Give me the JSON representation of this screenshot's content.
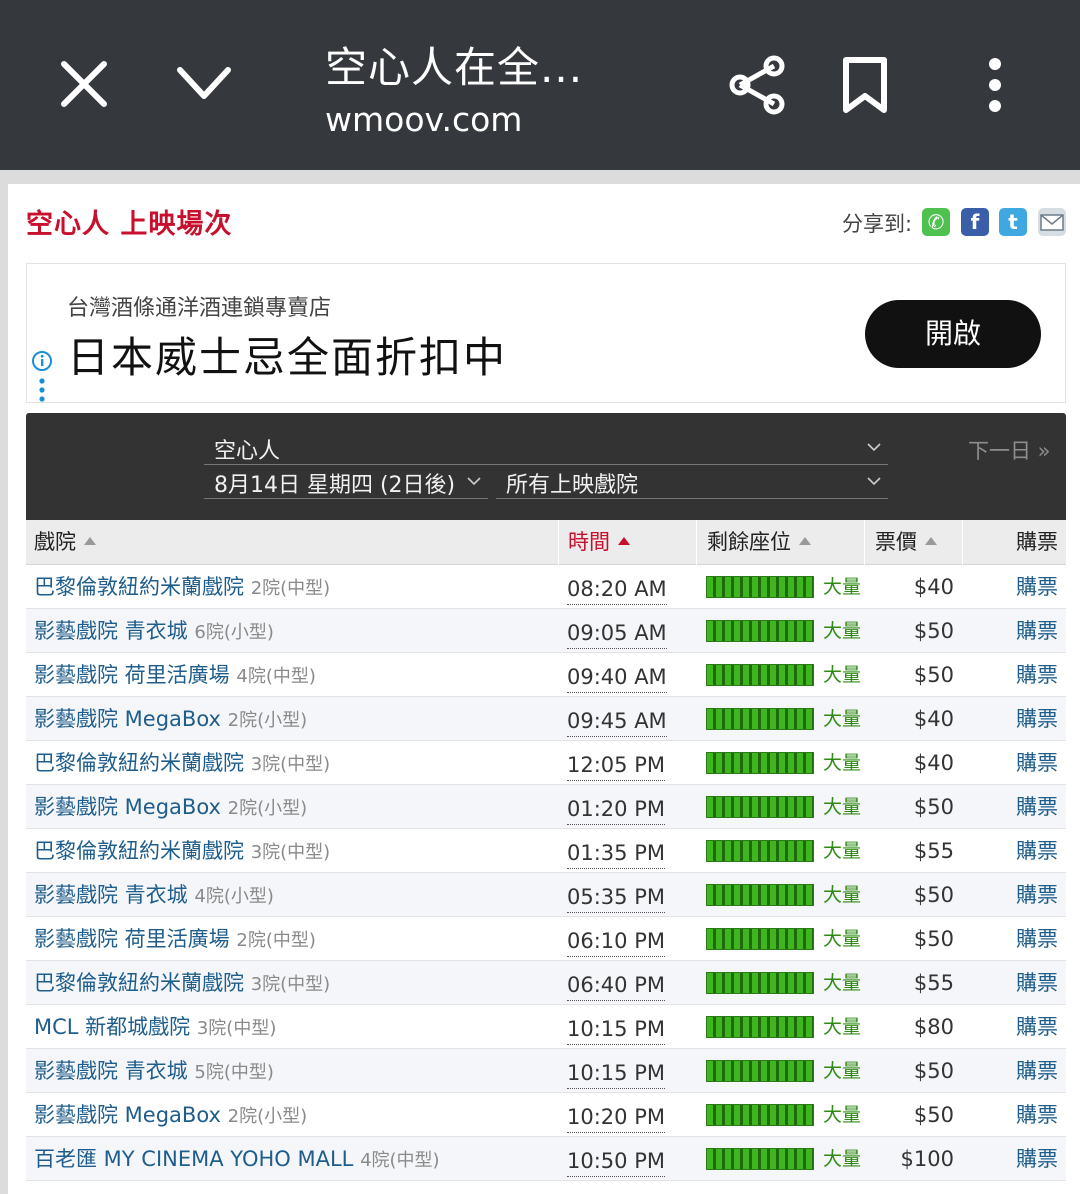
{
  "browser": {
    "title": "空心人在全...",
    "url": "wmoov.com",
    "icons": [
      "close-icon",
      "chevron-down-icon",
      "share-icon",
      "bookmark-icon",
      "more-vert-icon"
    ]
  },
  "page": {
    "title": "空心人 上映場次",
    "share_label": "分享到:",
    "share_icons": [
      "whatsapp-icon",
      "facebook-icon",
      "twitter-icon",
      "email-icon"
    ],
    "accent_color": "#c8102e"
  },
  "ad": {
    "subtitle": "台灣酒條通洋酒連鎖專賣店",
    "headline": "日本威士忌全面折扣中",
    "button": "開啟"
  },
  "filters": {
    "movie": "空心人",
    "date": "8月14日 星期四 (2日後)",
    "cinema": "所有上映戲院",
    "next_day": "下一日 »"
  },
  "table": {
    "headers": {
      "cinema": "戲院",
      "time": "時間",
      "seats": "剩餘座位",
      "price": "票價",
      "buy": "購票"
    },
    "rows": [
      {
        "cinema": "巴黎倫敦紐約米蘭戲院",
        "hall": "2院(中型)",
        "time": "08:20 AM",
        "seats": "大量",
        "price": "$40",
        "buy": "購票"
      },
      {
        "cinema": "影藝戲院 青衣城",
        "hall": "6院(小型)",
        "time": "09:05 AM",
        "seats": "大量",
        "price": "$50",
        "buy": "購票"
      },
      {
        "cinema": "影藝戲院 荷里活廣場",
        "hall": "4院(中型)",
        "time": "09:40 AM",
        "seats": "大量",
        "price": "$50",
        "buy": "購票"
      },
      {
        "cinema": "影藝戲院 MegaBox",
        "hall": "2院(小型)",
        "time": "09:45 AM",
        "seats": "大量",
        "price": "$40",
        "buy": "購票"
      },
      {
        "cinema": "巴黎倫敦紐約米蘭戲院",
        "hall": "3院(中型)",
        "time": "12:05 PM",
        "seats": "大量",
        "price": "$40",
        "buy": "購票"
      },
      {
        "cinema": "影藝戲院 MegaBox",
        "hall": "2院(小型)",
        "time": "01:20 PM",
        "seats": "大量",
        "price": "$50",
        "buy": "購票"
      },
      {
        "cinema": "巴黎倫敦紐約米蘭戲院",
        "hall": "3院(中型)",
        "time": "01:35 PM",
        "seats": "大量",
        "price": "$55",
        "buy": "購票"
      },
      {
        "cinema": "影藝戲院 青衣城",
        "hall": "4院(小型)",
        "time": "05:35 PM",
        "seats": "大量",
        "price": "$50",
        "buy": "購票"
      },
      {
        "cinema": "影藝戲院 荷里活廣場",
        "hall": "2院(中型)",
        "time": "06:10 PM",
        "seats": "大量",
        "price": "$50",
        "buy": "購票"
      },
      {
        "cinema": "巴黎倫敦紐約米蘭戲院",
        "hall": "3院(中型)",
        "time": "06:40 PM",
        "seats": "大量",
        "price": "$55",
        "buy": "購票"
      },
      {
        "cinema": "MCL 新都城戲院",
        "hall": "3院(中型)",
        "time": "10:15 PM",
        "seats": "大量",
        "price": "$80",
        "buy": "購票"
      },
      {
        "cinema": "影藝戲院 青衣城",
        "hall": "5院(中型)",
        "time": "10:15 PM",
        "seats": "大量",
        "price": "$50",
        "buy": "購票"
      },
      {
        "cinema": "影藝戲院 MegaBox",
        "hall": "2院(小型)",
        "time": "10:20 PM",
        "seats": "大量",
        "price": "$50",
        "buy": "購票"
      },
      {
        "cinema": "百老匯 MY CINEMA YOHO MALL",
        "hall": "4院(中型)",
        "time": "10:50 PM",
        "seats": "大量",
        "price": "$100",
        "buy": "購票"
      }
    ]
  }
}
